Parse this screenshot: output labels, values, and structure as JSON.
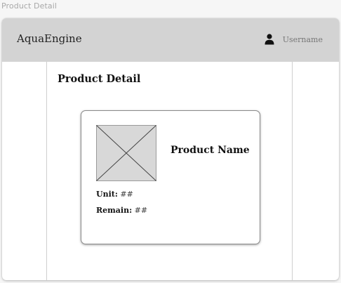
{
  "page_caption": "Product Detail",
  "header": {
    "app_title": "AquaEngine",
    "username": "Username",
    "user_icon": "person-icon",
    "background": "#d3d3d3"
  },
  "main": {
    "title": "Product Detail",
    "card": {
      "image_icon": "image-placeholder-icon",
      "product_name": "Product Name",
      "unit_label": "Unit:",
      "unit_value": "##",
      "remain_label": "Remain:",
      "remain_value": "##"
    }
  }
}
